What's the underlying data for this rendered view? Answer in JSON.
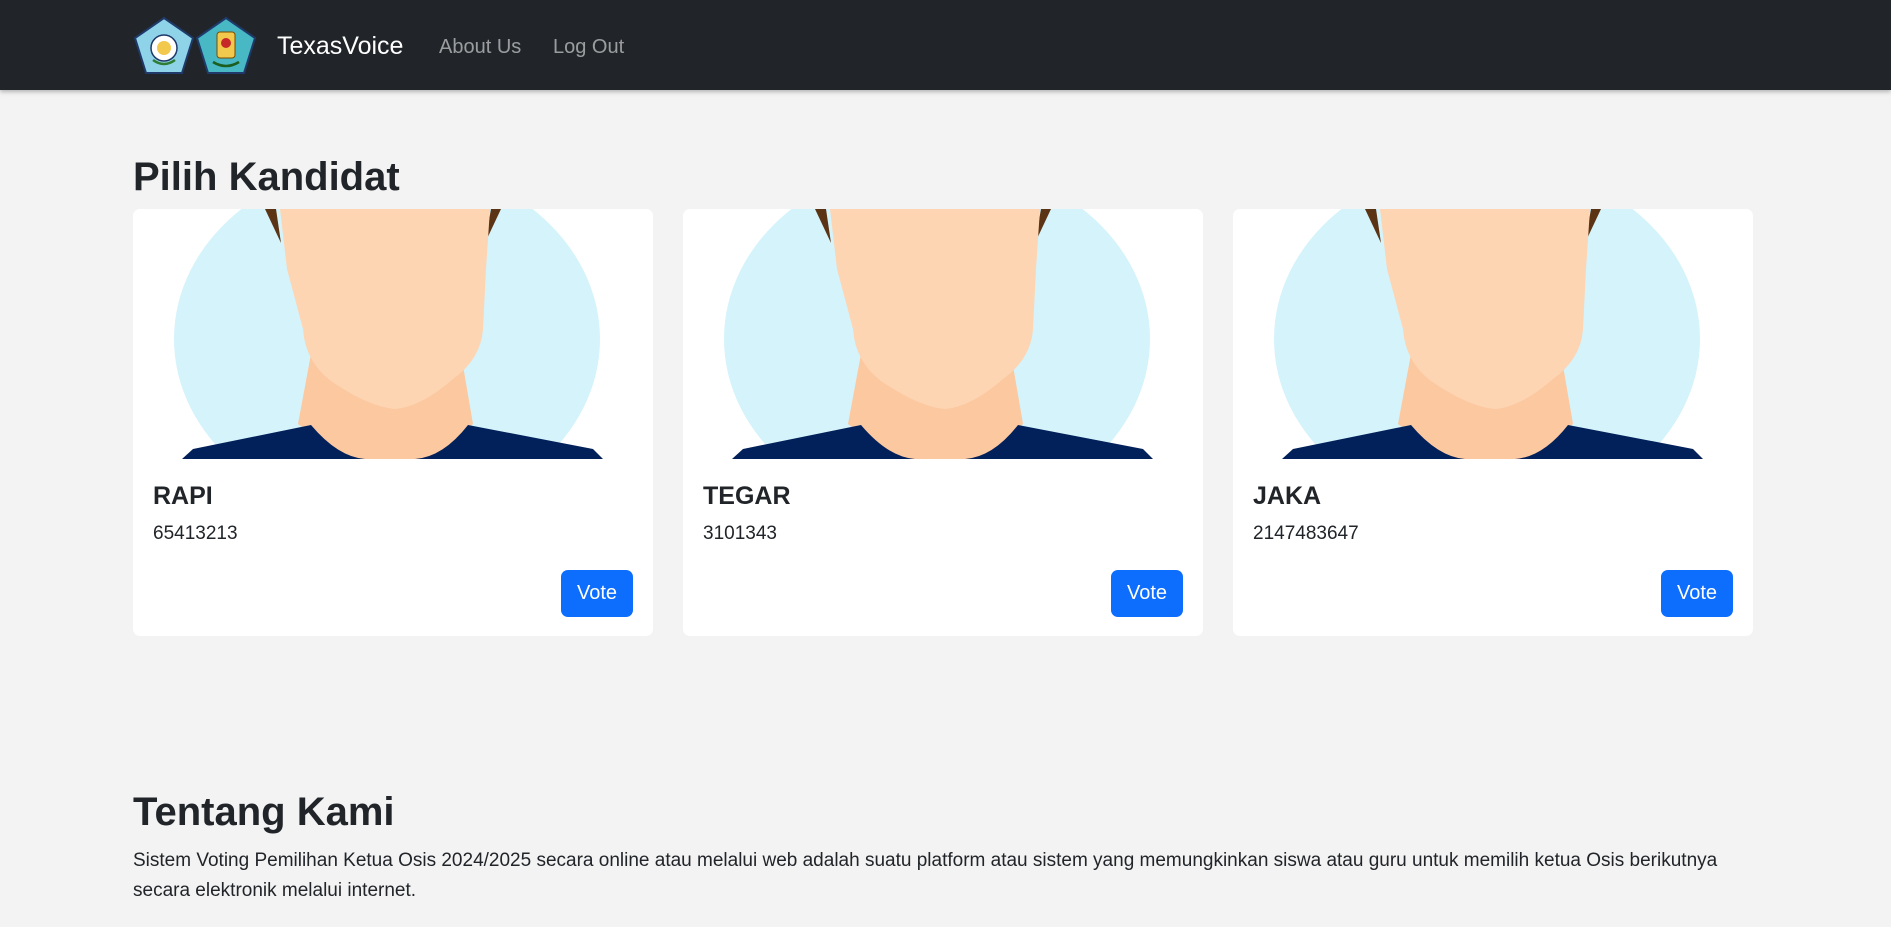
{
  "navbar": {
    "logos": [
      {
        "name": "school-emblem-logo",
        "color": "#8fd3e8"
      },
      {
        "name": "region-emblem-logo",
        "color": "#47b8c4"
      }
    ],
    "brand": "TexasVoice",
    "links": [
      "About Us",
      "Log Out"
    ]
  },
  "candidates_section": {
    "title": "Pilih Kandidat",
    "cards": [
      {
        "name": "RAPI",
        "number": "65413213",
        "button": "Vote",
        "image": "person-avatar"
      },
      {
        "name": "TEGAR",
        "number": "3101343",
        "button": "Vote",
        "image": "person-avatar"
      },
      {
        "name": "JAKA",
        "number": "2147483647",
        "button": "Vote",
        "image": "person-avatar"
      }
    ]
  },
  "about_section": {
    "title": "Tentang Kami",
    "text": "Sistem Voting Pemilihan Ketua Osis 2024/2025 secara online atau melalui web adalah suatu platform atau sistem yang memungkinkan siswa atau guru untuk memilih ketua Osis berikutnya secara elektronik melalui internet."
  },
  "colors": {
    "navbar_bg": "#212529",
    "page_bg": "#f3f3f3",
    "primary": "#0d6efd",
    "avatar_bg": "#d5f3fb",
    "skin": "#fdd5b3",
    "hair": "#5a3415",
    "shirt": "#02205a"
  }
}
